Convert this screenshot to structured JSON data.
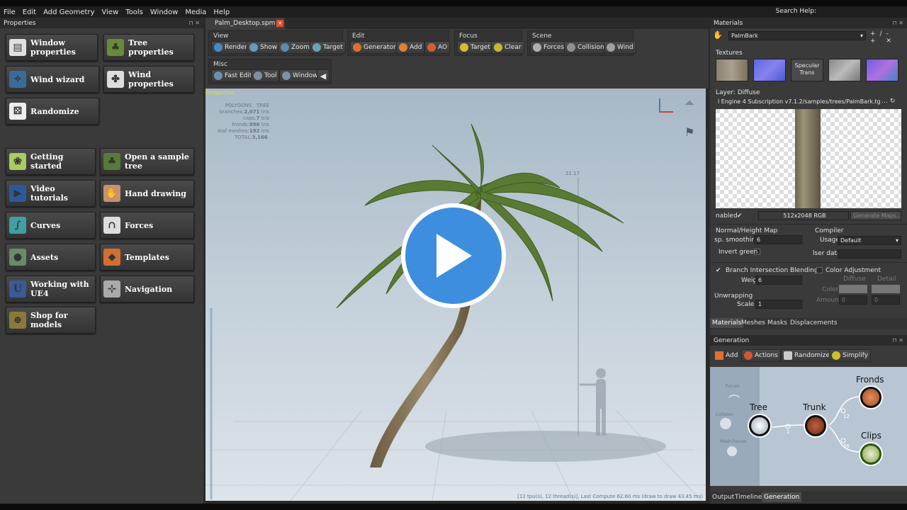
{
  "menu": [
    "File",
    "Edit",
    "Add Geometry",
    "View",
    "Tools",
    "Window",
    "Media",
    "Help"
  ],
  "search_help": "Search Help:",
  "left": {
    "title": "Properties",
    "buttons": [
      {
        "label": "Window properties",
        "icon": "document-icon"
      },
      {
        "label": "Tree properties",
        "icon": "tree-list-icon"
      },
      {
        "label": "Wind wizard",
        "icon": "wind-wizard-icon"
      },
      {
        "label": "Wind properties",
        "icon": "fan-icon"
      },
      {
        "label": "Randomize",
        "icon": "dice-icon"
      },
      {
        "label": "Getting started",
        "icon": "leaf-icon"
      },
      {
        "label": "Open a sample tree",
        "icon": "sample-tree-icon"
      },
      {
        "label": "Video tutorials",
        "icon": "play-circle-icon"
      },
      {
        "label": "Hand drawing",
        "icon": "hand-icon"
      },
      {
        "label": "Curves",
        "icon": "curve-icon"
      },
      {
        "label": "Forces",
        "icon": "magnet-icon"
      },
      {
        "label": "Assets",
        "icon": "sphere-icon"
      },
      {
        "label": "Templates",
        "icon": "templates-icon"
      },
      {
        "label": "Working with UE4",
        "icon": "unreal-icon"
      },
      {
        "label": "Navigation",
        "icon": "navigation-icon"
      },
      {
        "label": "Shop for models",
        "icon": "shop-icon"
      }
    ]
  },
  "doc_tab": "Palm_Desktop.spm",
  "toolbar": {
    "view": {
      "label": "View",
      "items": [
        "Render",
        "Show",
        "Zoom",
        "Target"
      ]
    },
    "edit": {
      "label": "Edit",
      "items": [
        "Generators",
        "Add",
        "AO"
      ]
    },
    "focus": {
      "label": "Focus",
      "items": [
        "Target",
        "Clear"
      ]
    },
    "scene": {
      "label": "Scene",
      "items": [
        "Forces",
        "Collision",
        "Wind"
      ]
    },
    "misc": {
      "label": "Misc",
      "items": [
        "Fast Edit",
        "Tool",
        "Window"
      ]
    }
  },
  "viewport": {
    "perspective": "Perspective",
    "stats_header": [
      "POLYGONS",
      "TREE"
    ],
    "stats": [
      {
        "k": "branches:",
        "v": "2,071",
        "u": "tris"
      },
      {
        "k": "caps:",
        "v": "7",
        "u": "tris"
      },
      {
        "k": "fronds:",
        "v": "896",
        "u": "tris"
      },
      {
        "k": "leaf meshes:",
        "v": "192",
        "u": "tris"
      },
      {
        "k": "TOTAL:",
        "v": "3,166",
        "u": ""
      }
    ],
    "height_label": "22.17",
    "footer": "[12 tpu(s), 12 thread(s)], Last Compute 62.60 ms (draw to draw 43.45 ms)"
  },
  "materials": {
    "title": "Materials",
    "material_name": "PalmBark",
    "textures_label": "Textures",
    "specular_label": "Specular Trans",
    "layer_label": "Layer: Diffuse",
    "path": "l Engine 4 Subscription v7.1.2/samples/trees/PalmBark.tga",
    "enabled_label": "nabled",
    "image_info": "512x2048  RGB",
    "generate_label": "Generate Maps...",
    "normal_label": "Normal/Height Map",
    "smoothing_label": "sp. smoothing",
    "smoothing_value": "6",
    "invert_label": "Invert green",
    "compiler_label": "Compiler",
    "usage_label": "Usage",
    "usage_value": "Default",
    "user_data_label": "lser data",
    "branch_label": "Branch Intersection Blending",
    "weight_label": "Weight",
    "weight_value": "6",
    "color_adj_label": "Color Adjustment",
    "diffuse_label": "Diffuse",
    "detail_label": "Detail",
    "color_label": "Color",
    "amount_label": "Amount",
    "amount_value_1": "0",
    "amount_value_2": "0",
    "unwrap_label": "Unwrapping",
    "scale_label": "Scale",
    "scale_value": "1",
    "tabs": [
      "Materials",
      "Meshes",
      "Masks",
      "Displacements"
    ]
  },
  "generation": {
    "title": "Generation",
    "tools": [
      "Add",
      "Actions",
      "Randomize",
      "Simplify"
    ],
    "nodes": {
      "tree": "Tree",
      "trunk": "Trunk",
      "fronds": "Fronds",
      "clips": "Clips"
    },
    "small_nodes": [
      "Forces",
      "Collision",
      "Mesh Forces"
    ],
    "edge_labels": [
      "1",
      "12",
      "36"
    ],
    "bottom_tabs": [
      "Output",
      "Timeline",
      "Generation"
    ]
  },
  "play_button": "play-icon"
}
